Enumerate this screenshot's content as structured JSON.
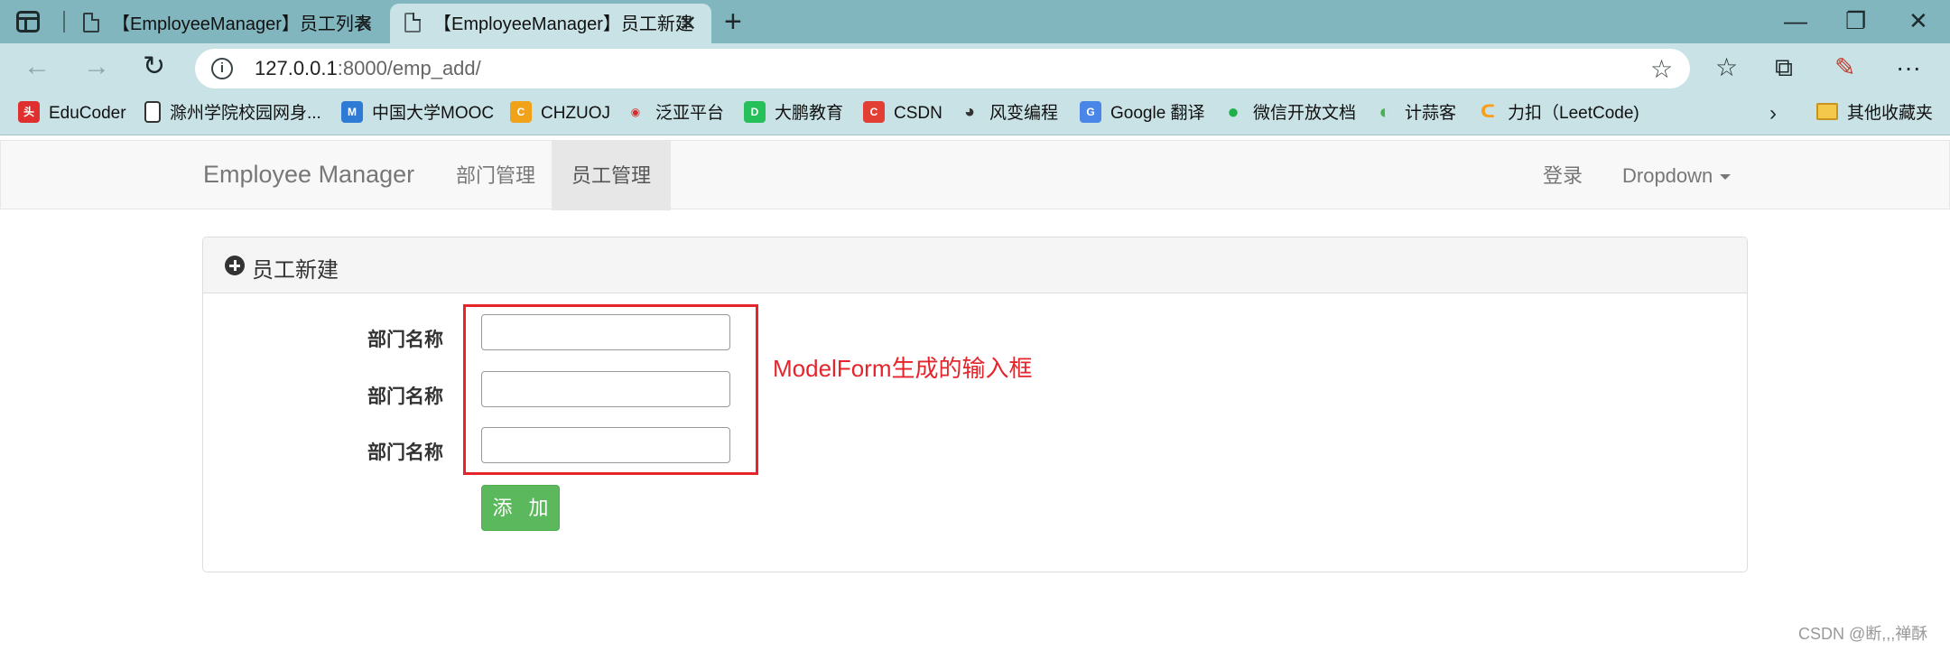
{
  "browser": {
    "tabs": [
      {
        "title": "【EmployeeManager】员工列表",
        "close": "✕"
      },
      {
        "title": "【EmployeeManager】员工新建",
        "close": "✕"
      }
    ],
    "new_tab": "+",
    "window_controls": {
      "minimize": "—",
      "restore": "❐",
      "close": "✕"
    },
    "nav": {
      "back": "←",
      "forward": "→",
      "reload": "↻"
    },
    "url_host": "127.0.0.1",
    "url_rest": ":8000/emp_add/",
    "toolbar_icons": {
      "favorites": "☆",
      "collections": "⧉",
      "more": "···"
    },
    "bookmarks": [
      {
        "label": "EduCoder",
        "icon": "toutiao-icon",
        "color": "#e02f2f",
        "glyph": "头"
      },
      {
        "label": "滁州学院校园网身...",
        "icon": "page-icon",
        "color": "#ffffff",
        "glyph": ""
      },
      {
        "label": "中国大学MOOC",
        "icon": "mooc-icon",
        "color": "#2e7bd6",
        "glyph": "M"
      },
      {
        "label": "CHZUOJ",
        "icon": "chzuoj-icon",
        "color": "#f0a21a",
        "glyph": "C"
      },
      {
        "label": "泛亚平台",
        "icon": "fanya-icon",
        "color": "#d92a2a",
        "glyph": "◉"
      },
      {
        "label": "大鹏教育",
        "icon": "dapeng-icon",
        "color": "#25c05a",
        "glyph": "D"
      },
      {
        "label": "CSDN",
        "icon": "csdn-icon",
        "color": "#e33e33",
        "glyph": "C"
      },
      {
        "label": "风变编程",
        "icon": "panda-icon",
        "color": "#333333",
        "glyph": "◕"
      },
      {
        "label": "Google 翻译",
        "icon": "google-translate-icon",
        "color": "#4a86e8",
        "glyph": "G"
      },
      {
        "label": "微信开放文档",
        "icon": "wechat-icon",
        "color": "#20b04b",
        "glyph": "●"
      },
      {
        "label": "计蒜客",
        "icon": "jisuanke-icon",
        "color": "#4cb050",
        "glyph": "◐"
      },
      {
        "label": "力扣（LeetCode)",
        "icon": "leetcode-icon",
        "color": "#f89f1b",
        "glyph": "ᑕ"
      }
    ],
    "bookmarks_more": "›",
    "other_bookmarks": "其他收藏夹"
  },
  "navbar": {
    "brand": "Employee Manager",
    "items": [
      "部门管理",
      "员工管理"
    ],
    "login": "登录",
    "dropdown": "Dropdown"
  },
  "panel": {
    "title": "员工新建",
    "fields": [
      {
        "label": "部门名称",
        "value": ""
      },
      {
        "label": "部门名称",
        "value": ""
      },
      {
        "label": "部门名称",
        "value": ""
      }
    ],
    "submit": "添 加"
  },
  "annotation": "ModelForm生成的输入框",
  "watermark": "CSDN @断,,,禅酥"
}
